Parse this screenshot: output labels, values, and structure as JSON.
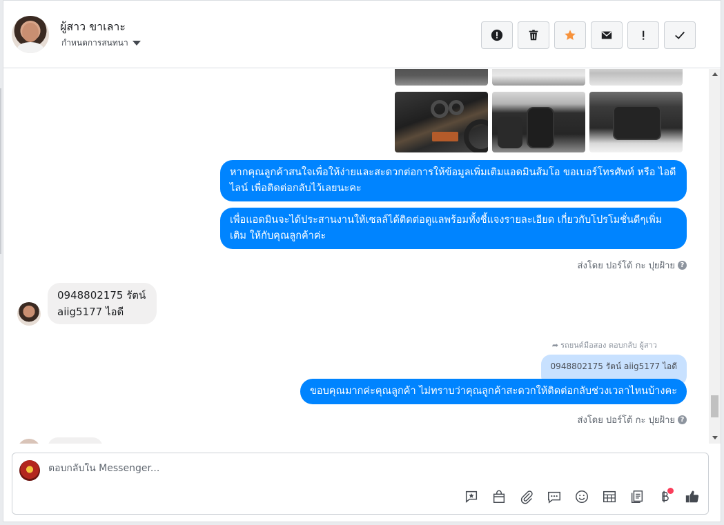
{
  "header": {
    "name": "ผู้สาว ขาเลาะ",
    "subtitle": "กำหนดการสนทนา",
    "toolbar": [
      {
        "icon": "alert-circle-icon",
        "name": "mark-spam-button"
      },
      {
        "icon": "trash-icon",
        "name": "delete-button"
      },
      {
        "icon": "star-icon",
        "name": "star-button"
      },
      {
        "icon": "envelope-icon",
        "name": "mark-unread-button"
      },
      {
        "icon": "exclamation-icon",
        "name": "follow-up-button"
      },
      {
        "icon": "check-icon",
        "name": "mark-done-button"
      }
    ],
    "star_color": "#f7923b"
  },
  "messages": {
    "out1": "หากคุณลูกค้าสนใจเพื่อให้ง่ายและสะดวกต่อการให้ข้อมูลเพิ่มเติมแอดมินส้มโอ ขอเบอร์โทรศัพท์ หรือ ไอดีไลน์ เพื่อติดต่อกลับไว้เลยนะคะ",
    "out2": "เพื่อแอดมินจะได้ประสานงานให้เซลล์ได้ติดต่อดูแลพร้อมทั้งชี้แจงรายละเอียด เกี่ยวกับโปรโมชั่นดีๆเพิ่มเติม ให้กับคุณลูกค้าค่ะ",
    "sent_by_1": "ส่งโดย ปอร์โต้ กะ ปุยฝ้าย",
    "in1": "0948802175 รัตน์ aiig5177 ไอดี",
    "reply_meta": "รถยนต์มือสอง ตอบกลับ ผู้สาว",
    "quoted": "0948802175 รัตน์ aiig5177 ไอดี",
    "out3": "ขอบคุณมากค่ะคุณลูกค้า ไม่ทราบว่าคุณลูกค้าสะดวกให้ติดต่อกลับช่วงเวลาไหนบ้างคะ",
    "sent_by_2": "ส่งโดย ปอร์โต้ กะ ปุยฝ้าย",
    "help_icon": "?"
  },
  "colors": {
    "outgoing_bubble": "#0084ff",
    "incoming_bubble": "#f1f0f0",
    "quoted_bubble": "#c8e1ff"
  },
  "composer": {
    "placeholder": "ตอบกลับใน Messenger...",
    "value": "",
    "tools": [
      "saved-reply-icon",
      "shop-bag-icon",
      "attachment-icon",
      "chat-bubble-icon",
      "emoji-icon",
      "table-icon",
      "notes-icon",
      "baht-payment-icon",
      "thumbs-up-icon"
    ]
  }
}
